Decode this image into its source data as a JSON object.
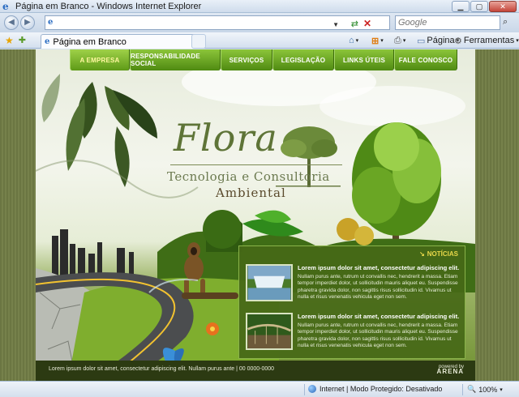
{
  "window": {
    "title": "Página em Branco - Windows Internet Explorer"
  },
  "address": {
    "url": "",
    "search_placeholder": "Google"
  },
  "tab": {
    "label": "Página em Branco"
  },
  "commandbar": {
    "page_label": "Página",
    "tools_label": "Ferramentas"
  },
  "site": {
    "menu": [
      "A EMPRESA",
      "RESPONSABILIDADE SOCIAL",
      "SERVIÇOS",
      "LEGISLAÇÃO",
      "LINKS ÚTEIS",
      "FALE CONOSCO"
    ],
    "logo": {
      "word": "Flora",
      "tagline": "Tecnologia e Consultoria",
      "tagline2": "Ambiental"
    },
    "news": {
      "heading": "NOTÍCIAS",
      "items": [
        {
          "title": "Lorem ipsum dolor sit amet, consectetur adipiscing elit.",
          "body": "Nullam purus ante, rutrum ut convallis nec, hendrerit a massa. Etiam tempor imperdiet dolor, ut sollicitudin mauris aliquet eu. Suspendisse pharetra gravida dolor, non sagittis risus sollicitudin id. Vivamus ut nulla et risus venenatis vehicula eget non sem."
        },
        {
          "title": "Lorem ipsum dolor sit amet, consectetur adipiscing elit.",
          "body": "Nullam purus ante, rutrum ut convallis nec, hendrerit a massa. Etiam tempor imperdiet dolor, ut sollicitudin mauris aliquet eu. Suspendisse pharetra gravida dolor, non sagittis risus sollicitudin id. Vivamus ut nulla et risus venenatis vehicula eget non sem."
        }
      ]
    },
    "footer": {
      "text": "Lorem ipsum dolor sit amet, consectetur adipiscing elit. Nullam purus ante | 00 0000-0000",
      "powered_by": "powered by",
      "brand": "ARENA"
    }
  },
  "status": {
    "zone": "Internet | Modo Protegido: Desativado",
    "zoom": "100%"
  },
  "colors": {
    "menu_green": "#6aa624",
    "news_bg": "#466817",
    "heading_yellow": "#e8d84a",
    "footer_bg": "#2c3a12"
  }
}
